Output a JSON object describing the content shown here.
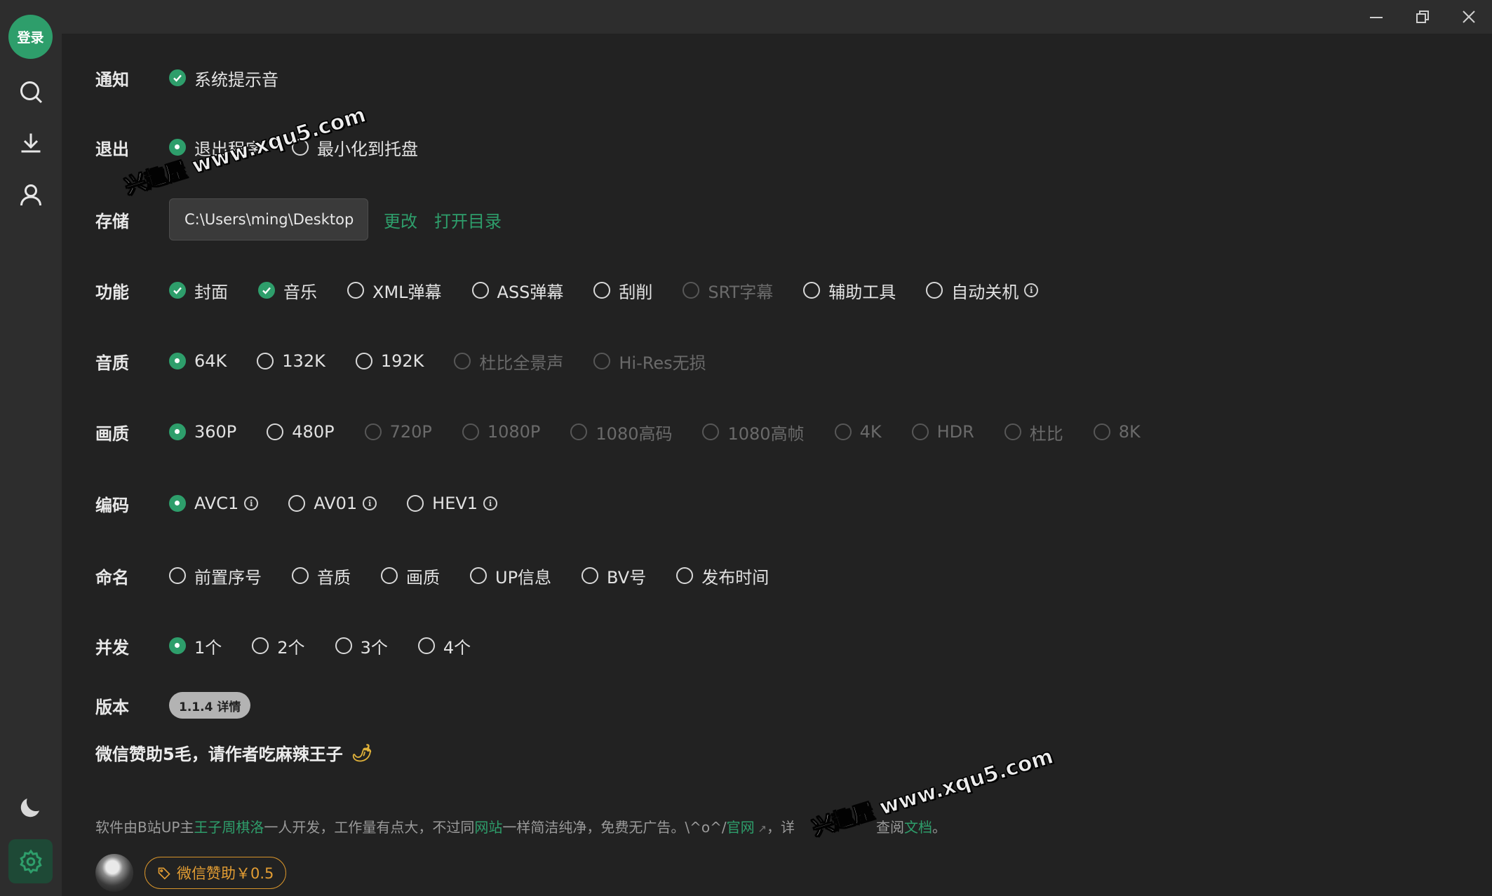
{
  "sidebar": {
    "login_label": "登录",
    "icons": [
      "search-icon",
      "download-icon",
      "user-icon",
      "moon-icon",
      "gear-icon"
    ]
  },
  "window_controls": [
    "minimize-icon",
    "restore-icon",
    "close-icon"
  ],
  "settings": {
    "notify": {
      "label": "通知",
      "options": [
        {
          "text": "系统提示音",
          "state": "checked"
        }
      ]
    },
    "exit": {
      "label": "退出",
      "options": [
        {
          "text": "退出程序",
          "state": "on"
        },
        {
          "text": "最小化到托盘",
          "state": "off"
        }
      ]
    },
    "storage": {
      "label": "存储",
      "path": "C:\\Users\\ming\\Desktop",
      "change": "更改",
      "open_dir": "打开目录"
    },
    "features": {
      "label": "功能",
      "options": [
        {
          "text": "封面",
          "state": "checked"
        },
        {
          "text": "音乐",
          "state": "checked"
        },
        {
          "text": "XML弹幕",
          "state": "off"
        },
        {
          "text": "ASS弹幕",
          "state": "off"
        },
        {
          "text": "刮削",
          "state": "off"
        },
        {
          "text": "SRT字幕",
          "state": "disabled"
        },
        {
          "text": "辅助工具",
          "state": "off"
        },
        {
          "text": "自动关机",
          "state": "off"
        }
      ]
    },
    "audio_quality": {
      "label": "音质",
      "options": [
        {
          "text": "64K",
          "state": "on"
        },
        {
          "text": "132K",
          "state": "off"
        },
        {
          "text": "192K",
          "state": "off"
        },
        {
          "text": "杜比全景声",
          "state": "disabled"
        },
        {
          "text": "Hi-Res无损",
          "state": "disabled"
        }
      ]
    },
    "video_quality": {
      "label": "画质",
      "options": [
        {
          "text": "360P",
          "state": "on"
        },
        {
          "text": "480P",
          "state": "off"
        },
        {
          "text": "720P",
          "state": "disabled"
        },
        {
          "text": "1080P",
          "state": "disabled"
        },
        {
          "text": "1080高码",
          "state": "disabled"
        },
        {
          "text": "1080高帧",
          "state": "disabled"
        },
        {
          "text": "4K",
          "state": "disabled"
        },
        {
          "text": "HDR",
          "state": "disabled"
        },
        {
          "text": "杜比",
          "state": "disabled"
        },
        {
          "text": "8K",
          "state": "disabled"
        }
      ]
    },
    "codec": {
      "label": "编码",
      "options": [
        {
          "text": "AVC1",
          "state": "on"
        },
        {
          "text": "AV01",
          "state": "off"
        },
        {
          "text": "HEV1",
          "state": "off"
        }
      ]
    },
    "naming": {
      "label": "命名",
      "options": [
        {
          "text": "前置序号",
          "state": "off"
        },
        {
          "text": "音质",
          "state": "off"
        },
        {
          "text": "画质",
          "state": "off"
        },
        {
          "text": "UP信息",
          "state": "off"
        },
        {
          "text": "BV号",
          "state": "off"
        },
        {
          "text": "发布时间",
          "state": "off"
        }
      ]
    },
    "concurrency": {
      "label": "并发",
      "options": [
        {
          "text": "1个",
          "state": "on"
        },
        {
          "text": "2个",
          "state": "off"
        },
        {
          "text": "3个",
          "state": "off"
        },
        {
          "text": "4个",
          "state": "off"
        }
      ]
    },
    "version": {
      "label": "版本",
      "badge": "1.1.4 详情"
    }
  },
  "footer": {
    "donate_title": "微信赞助5毛，请作者吃麻辣王子",
    "desc": {
      "p1": "软件由B站UP主",
      "author": "王子周棋洛",
      "p2": "一人开发，工作量有点大，不过同",
      "site": "网站",
      "p3": "一样简洁纯净，免费无广告。\\^o^/",
      "official": "官网",
      "p4": "，详",
      "p5": "查阅",
      "docs": "文档",
      "p6": "。"
    },
    "donate_button": "微信赞助￥0.5"
  },
  "watermarks": [
    "兴趣屋 www.xqu5.com",
    "兴趣屋 www.xqu5.com"
  ],
  "colors": {
    "accent": "#2e9e6b",
    "sidebar_bg": "#2d2d2d",
    "content_bg": "#222222",
    "donate": "#e39d33"
  }
}
